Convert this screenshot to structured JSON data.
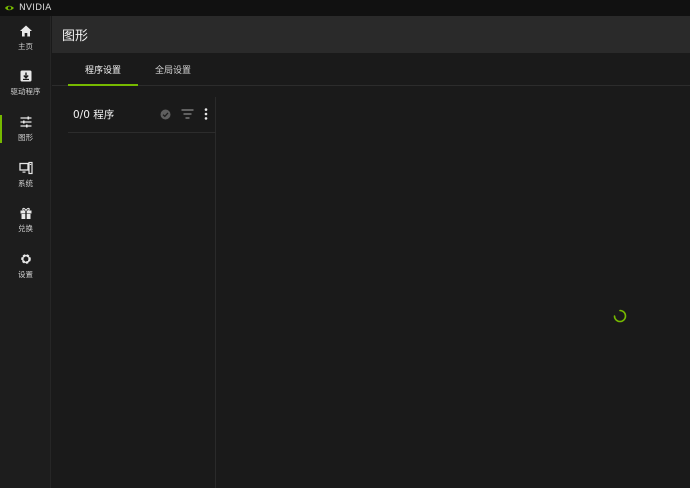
{
  "app": {
    "title": "NVIDIA",
    "accent": "#76b900"
  },
  "sidebar": {
    "items": [
      {
        "label": "主页",
        "icon": "home-icon"
      },
      {
        "label": "驱动程序",
        "icon": "driver-download-icon"
      },
      {
        "label": "图形",
        "icon": "sliders-icon",
        "active": true
      },
      {
        "label": "系统",
        "icon": "system-monitor-icon"
      },
      {
        "label": "兑换",
        "icon": "gift-icon"
      },
      {
        "label": "设置",
        "icon": "gear-icon"
      }
    ]
  },
  "header": {
    "title": "图形"
  },
  "tabs": [
    {
      "label": "程序设置",
      "active": true
    },
    {
      "label": "全局设置",
      "active": false
    }
  ],
  "program_panel": {
    "count_label": "0/0 程序",
    "icons": [
      "verified-check-icon",
      "filter-icon",
      "more-vertical-icon"
    ]
  },
  "content": {
    "loading": true
  }
}
